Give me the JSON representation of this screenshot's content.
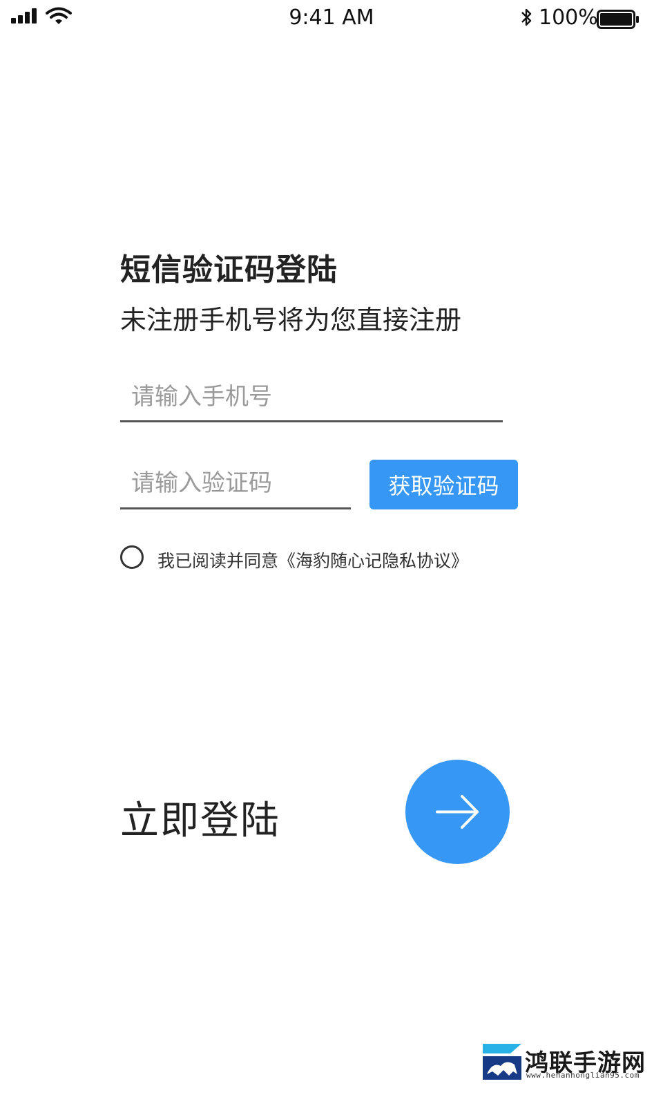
{
  "status_bar": {
    "time": "9:41 AM",
    "battery_percent": "100%",
    "icons": [
      "signal-icon",
      "wifi-icon",
      "bluetooth-icon",
      "battery-icon"
    ]
  },
  "login": {
    "title": "短信验证码登陆",
    "subtitle": "未注册手机号将为您直接注册",
    "phone_placeholder": "请输入手机号",
    "phone_value": "",
    "code_placeholder": "请输入验证码",
    "code_value": "",
    "get_code_label": "获取验证码",
    "agreement_text": "我已阅读并同意《海豹随心记隐私协议》",
    "agreement_checked": false,
    "submit_label": "立即登陆",
    "submit_icon": "arrow-right-icon"
  },
  "colors": {
    "accent": "#3697f5",
    "text": "#222222",
    "placeholder": "#9a9a9a"
  },
  "watermark": {
    "name": "鸿联手游网",
    "url": "www.henanhonglian95.com"
  }
}
